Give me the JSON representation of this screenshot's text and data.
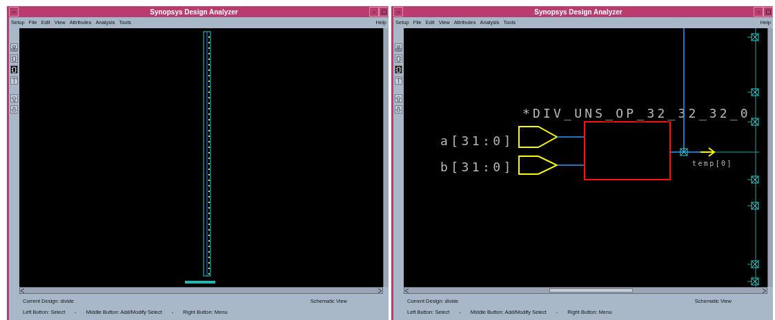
{
  "windows": [
    {
      "title": "Synopsys Design Analyzer",
      "menu": [
        "Setup",
        "File",
        "Edit",
        "View",
        "Attributes",
        "Analysis",
        "Tools"
      ],
      "help": "Help",
      "tools": [
        {
          "selected": false
        },
        {
          "selected": false
        },
        {
          "selected": true
        },
        {
          "selected": false
        },
        {
          "selected": false
        },
        {
          "selected": false
        }
      ],
      "canvas": {
        "kind": "overview"
      },
      "scroll_thumb": false,
      "status": {
        "design": "Current Design: divide",
        "view": "Schematic View",
        "hints": [
          "Left Button: Select",
          "-",
          "Middle Button: Add/Modify Select",
          "-",
          "Right Button: Menu"
        ]
      }
    },
    {
      "title": "Synopsys Design Analyzer",
      "menu": [
        "Setup",
        "File",
        "Edit",
        "View",
        "Attributes",
        "Analysis",
        "Tools"
      ],
      "help": "Help",
      "tools": [
        {
          "selected": false
        },
        {
          "selected": false
        },
        {
          "selected": true
        },
        {
          "selected": false
        },
        {
          "selected": false
        },
        {
          "selected": false
        }
      ],
      "canvas": {
        "kind": "schematic",
        "inputs": [
          "a[31:0]",
          "b[31:0]"
        ],
        "cell": "*DIV_UNS_OP_32_32_32_0",
        "output": "temp[0]"
      },
      "scroll_thumb": true,
      "status": {
        "design": "Current Design: divide",
        "view": "Schematic View",
        "hints": [
          "Left Button: Select",
          "-",
          "Middle Button: Add/Modify Select",
          "-",
          "Right Button: Menu"
        ]
      }
    }
  ]
}
